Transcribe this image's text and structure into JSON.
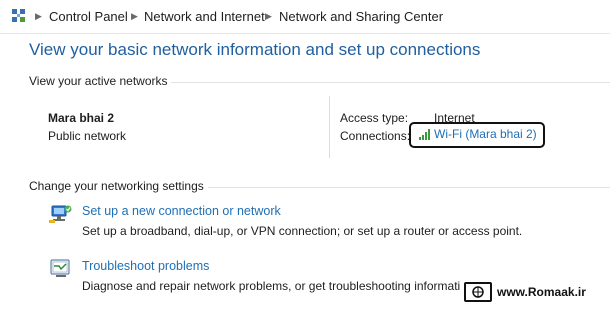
{
  "breadcrumb": {
    "items": [
      "Control Panel",
      "Network and Internet",
      "Network and Sharing Center"
    ]
  },
  "page_title": "View your basic network information and set up connections",
  "active_networks": {
    "heading": "View your active networks",
    "name": "Mara bhai 2",
    "type": "Public network",
    "access_type_label": "Access type:",
    "access_type_value": "Internet",
    "connections_label": "Connections:",
    "connection_link": "Wi-Fi (Mara bhai 2)"
  },
  "settings": {
    "heading": "Change your networking settings",
    "tasks": [
      {
        "title": "Set up a new connection or network",
        "description": "Set up a broadband, dial-up, or VPN connection; or set up a router or access point.",
        "icon": "network-setup-icon"
      },
      {
        "title": "Troubleshoot problems",
        "description": "Diagnose and repair network problems, or get troubleshooting informati",
        "icon": "troubleshoot-icon"
      }
    ]
  },
  "watermark": {
    "text": "www.Romaak.ir"
  },
  "colors": {
    "link": "#1f6fb5",
    "title": "#1f5f9f",
    "highlight_border": "#111111"
  }
}
